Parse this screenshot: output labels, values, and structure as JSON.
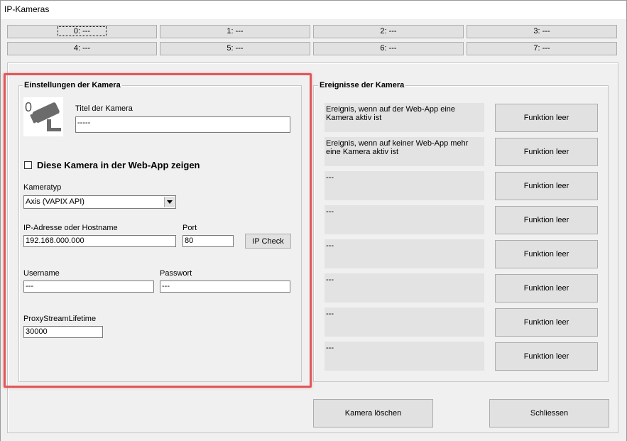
{
  "window": {
    "title": "IP-Kameras"
  },
  "tabs": [
    "0: ---",
    "1: ---",
    "2: ---",
    "3: ---",
    "4: ---",
    "5: ---",
    "6: ---",
    "7: ---"
  ],
  "settings": {
    "group_label": "Einstellungen der Kamera",
    "camera_icon": "security-camera-icon",
    "title_label": "Titel der Kamera",
    "title_value": "-----",
    "show_in_webapp_label": "Diese Kamera in der Web-App zeigen",
    "show_in_webapp_checked": false,
    "type_label": "Kameratyp",
    "type_value": "Axis (VAPIX API)",
    "ip_label": "IP-Adresse oder Hostname",
    "ip_value": "192.168.000.000",
    "port_label": "Port",
    "port_value": "80",
    "ip_check_label": "IP Check",
    "username_label": "Username",
    "username_value": "---",
    "password_label": "Passwort",
    "password_value": "---",
    "proxy_label": "ProxyStreamLifetime",
    "proxy_value": "30000"
  },
  "events": {
    "group_label": "Ereignisse der Kamera",
    "items": [
      {
        "text": "Ereignis, wenn auf der Web-App eine Kamera aktiv ist",
        "button": "Funktion leer"
      },
      {
        "text": "Ereignis, wenn auf keiner Web-App mehr eine Kamera aktiv ist",
        "button": "Funktion leer"
      },
      {
        "text": "---",
        "button": "Funktion leer"
      },
      {
        "text": "---",
        "button": "Funktion leer"
      },
      {
        "text": "---",
        "button": "Funktion leer"
      },
      {
        "text": "---",
        "button": "Funktion leer"
      },
      {
        "text": "---",
        "button": "Funktion leer"
      },
      {
        "text": "---",
        "button": "Funktion leer"
      }
    ]
  },
  "footer": {
    "delete_label": "Kamera löschen",
    "close_label": "Schliessen"
  },
  "colors": {
    "highlight": "#e15759"
  }
}
